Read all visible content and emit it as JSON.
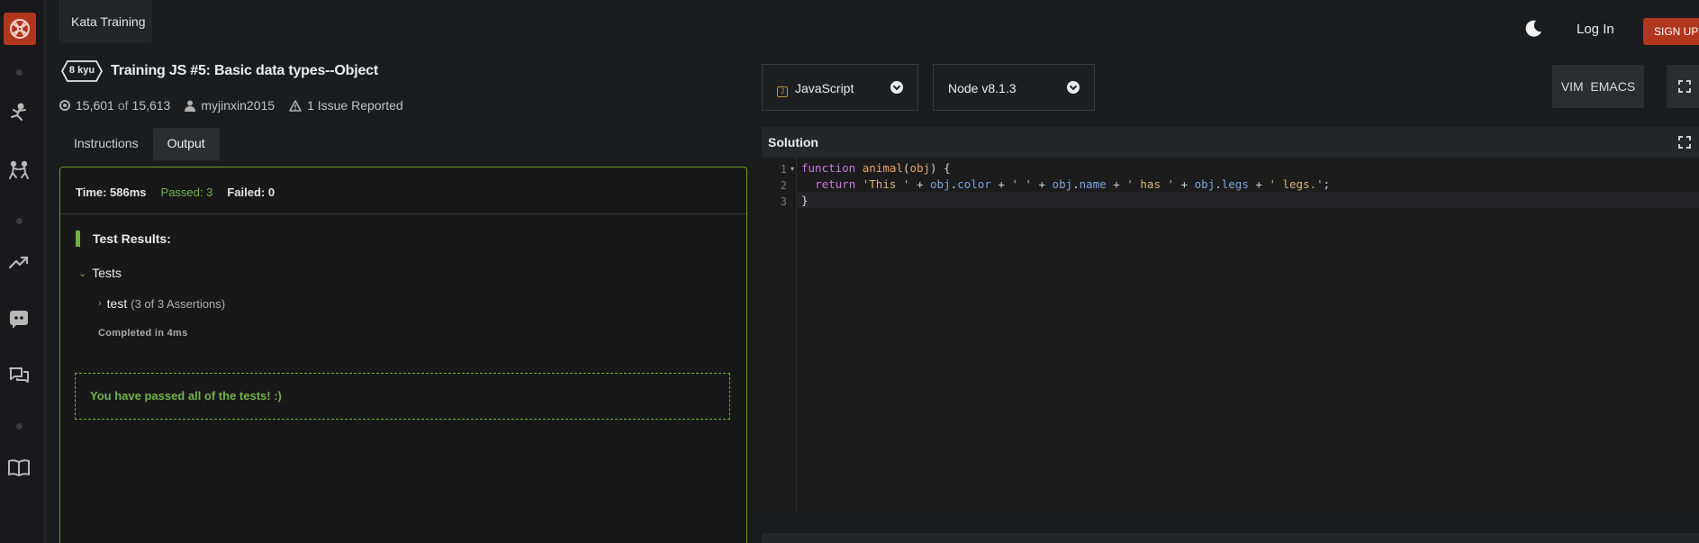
{
  "header": {
    "kata_training_tab": "Kata Training",
    "login_label": "Log In",
    "signup_label": "SIGN UP"
  },
  "kata": {
    "rank": "8 kyu",
    "title": "Training JS #5: Basic data types--Object",
    "completed_count": "15,601",
    "of_label": "of",
    "total_count": "15,613",
    "author": "myjinxin2015",
    "issues": "1 Issue Reported"
  },
  "tabs": {
    "instructions": "Instructions",
    "output": "Output"
  },
  "output": {
    "time": "Time: 586ms",
    "passed": "Passed: 3",
    "failed": "Failed: 0",
    "results_heading": "Test Results:",
    "group_label": "Tests",
    "test_name": "test",
    "test_assertions": "(3 of 3 Assertions)",
    "completed_in": "Completed in 4ms",
    "success_message": "You have passed all of the tests! :)"
  },
  "editor_controls": {
    "language": "JavaScript",
    "runtime": "Node v8.1.3",
    "vim_label": "VIM",
    "emacs_label": "EMACS"
  },
  "solution": {
    "heading": "Solution",
    "line_numbers": [
      "1",
      "2",
      "3"
    ],
    "lines": [
      "function animal(obj) {",
      "  return 'This ' + obj.color + ' ' + obj.name + ' has ' + obj.legs + ' legs.';",
      "}"
    ]
  },
  "colors": {
    "brand": "#b1361e",
    "success": "#6fb13c",
    "border_active": "#6d9e2b"
  },
  "icons": [
    "logo-icon",
    "kata-icon",
    "training-icon",
    "leaderboard-icon",
    "discord-icon",
    "discuss-icon",
    "docs-icon",
    "moon-icon",
    "javascript-icon",
    "chevron-down-icon",
    "fullscreen-icon",
    "expand-icon",
    "user-icon",
    "warning-icon",
    "completed-icon"
  ]
}
